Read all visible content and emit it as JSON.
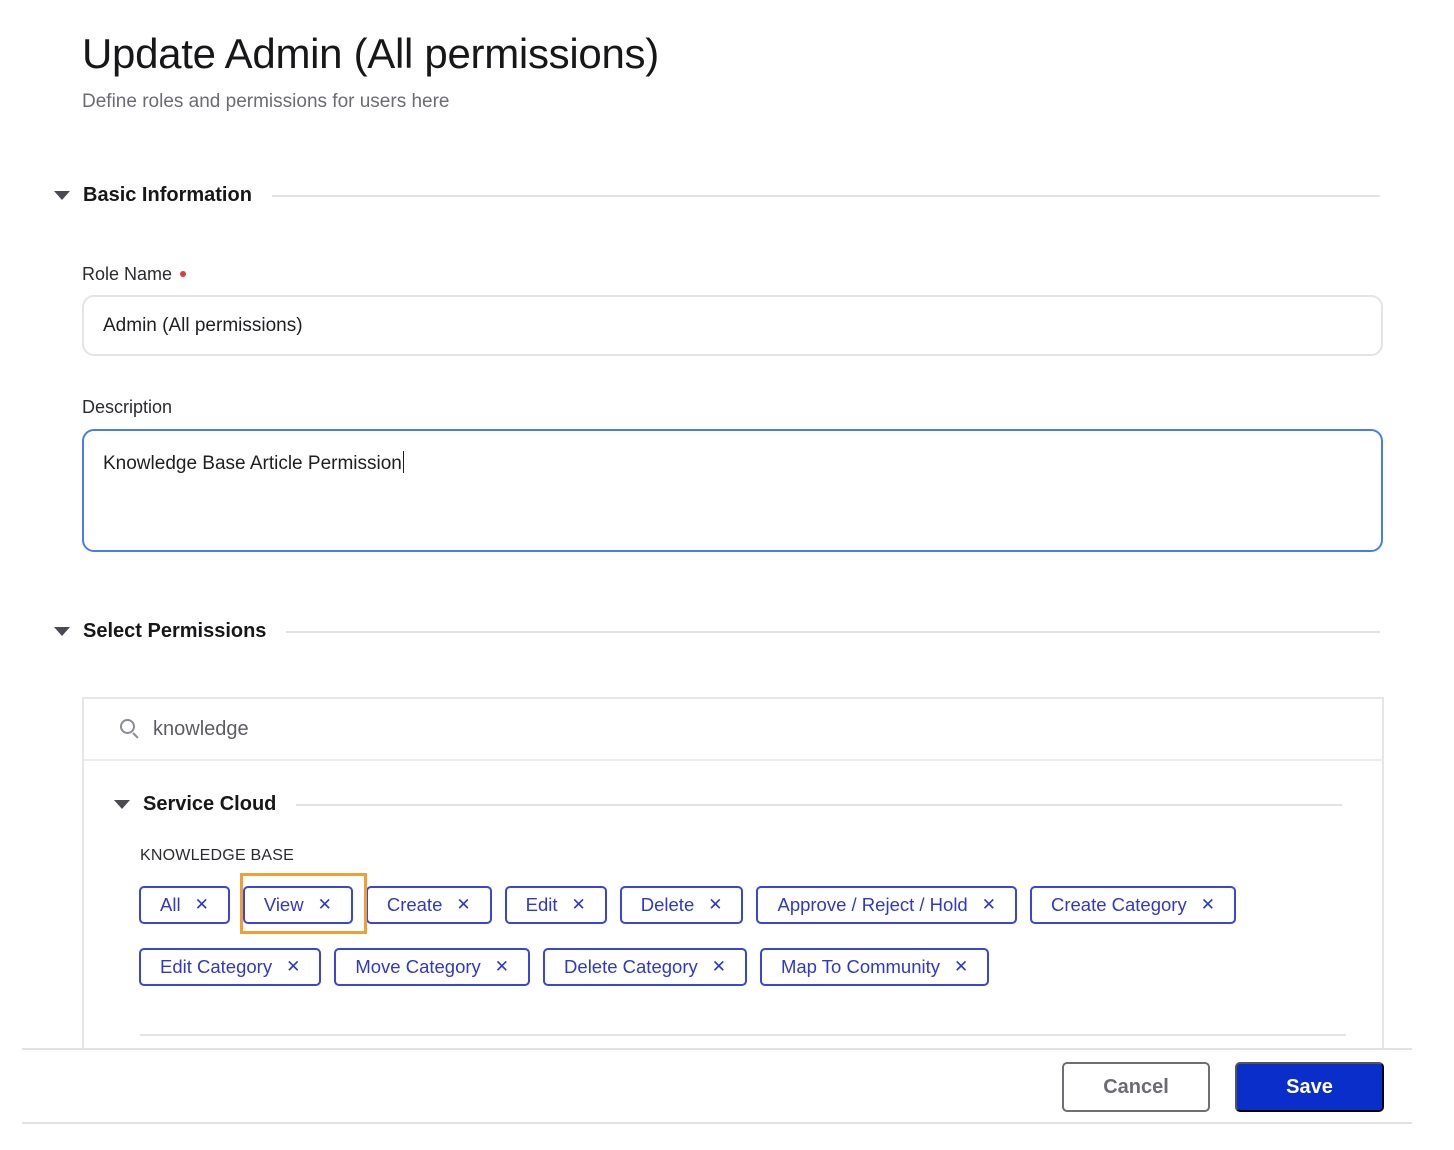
{
  "header": {
    "title": "Update Admin (All permissions)",
    "subtitle": "Define roles and permissions for users here"
  },
  "basic_info": {
    "section_title": "Basic Information",
    "role_name": {
      "label": "Role Name",
      "required": true,
      "value": "Admin (All permissions)"
    },
    "description": {
      "label": "Description",
      "value": "Knowledge Base Article Permission"
    }
  },
  "permissions": {
    "section_title": "Select Permissions",
    "search": {
      "icon": "search-icon",
      "value": "knowledge"
    },
    "groups": [
      {
        "title": "Service Cloud",
        "category": "KNOWLEDGE BASE",
        "tags_row1": [
          {
            "label": "All"
          },
          {
            "label": "View",
            "highlighted": true
          },
          {
            "label": "Create"
          },
          {
            "label": "Edit"
          },
          {
            "label": "Delete"
          },
          {
            "label": "Approve / Reject / Hold"
          },
          {
            "label": "Create Category"
          }
        ],
        "tags_row2": [
          {
            "label": "Edit Category"
          },
          {
            "label": "Move Category"
          },
          {
            "label": "Delete Category"
          },
          {
            "label": "Map To Community"
          }
        ],
        "remove_glyph": "✕"
      }
    ]
  },
  "footer": {
    "cancel_label": "Cancel",
    "save_label": "Save"
  },
  "colors": {
    "accent": "#0a2ec9",
    "tag_border": "#3b45d6",
    "focus_border": "#4a7cf0",
    "highlight": "#f0a030",
    "required": "#e0393e"
  }
}
